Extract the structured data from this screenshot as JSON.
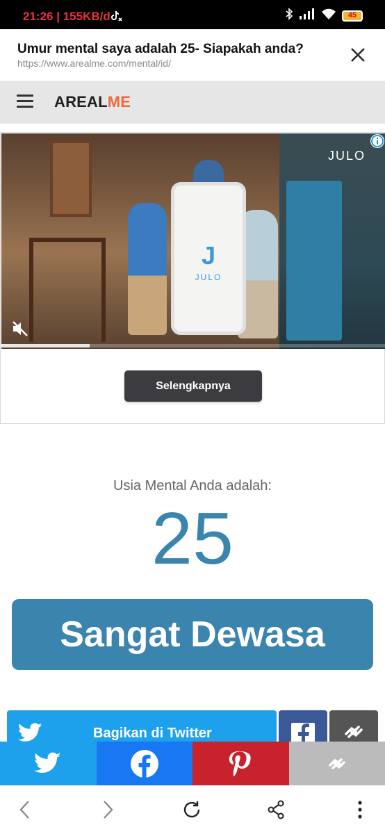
{
  "status_bar": {
    "time_speed": "21:26 | 155KB/d",
    "battery": "45"
  },
  "custom_tab": {
    "title": "Umur mental saya adalah 25- Siapakah anda?",
    "url": "https://www.arealme.com/mental/id/"
  },
  "site": {
    "logo_part1": "AREAL",
    "logo_part2": "ME"
  },
  "ad": {
    "brand_text": "JULO",
    "phone_logo": "J",
    "phone_word": "JULO",
    "cta_label": "Selengkapnya",
    "progress": 0.23
  },
  "result": {
    "label": "Usia Mental Anda adalah:",
    "age": "25",
    "verdict": "Sangat Dewasa"
  },
  "share": {
    "twitter_label": "Bagikan di Twitter"
  },
  "sticky_share": [
    "twitter-icon",
    "facebook-icon",
    "pinterest-icon",
    "link-icon"
  ],
  "colors": {
    "accent": "#3a84ad",
    "logo_accent": "#f0693a",
    "twitter": "#1ea1ec",
    "facebook": "#1877f2",
    "pinterest": "#c8232c"
  }
}
